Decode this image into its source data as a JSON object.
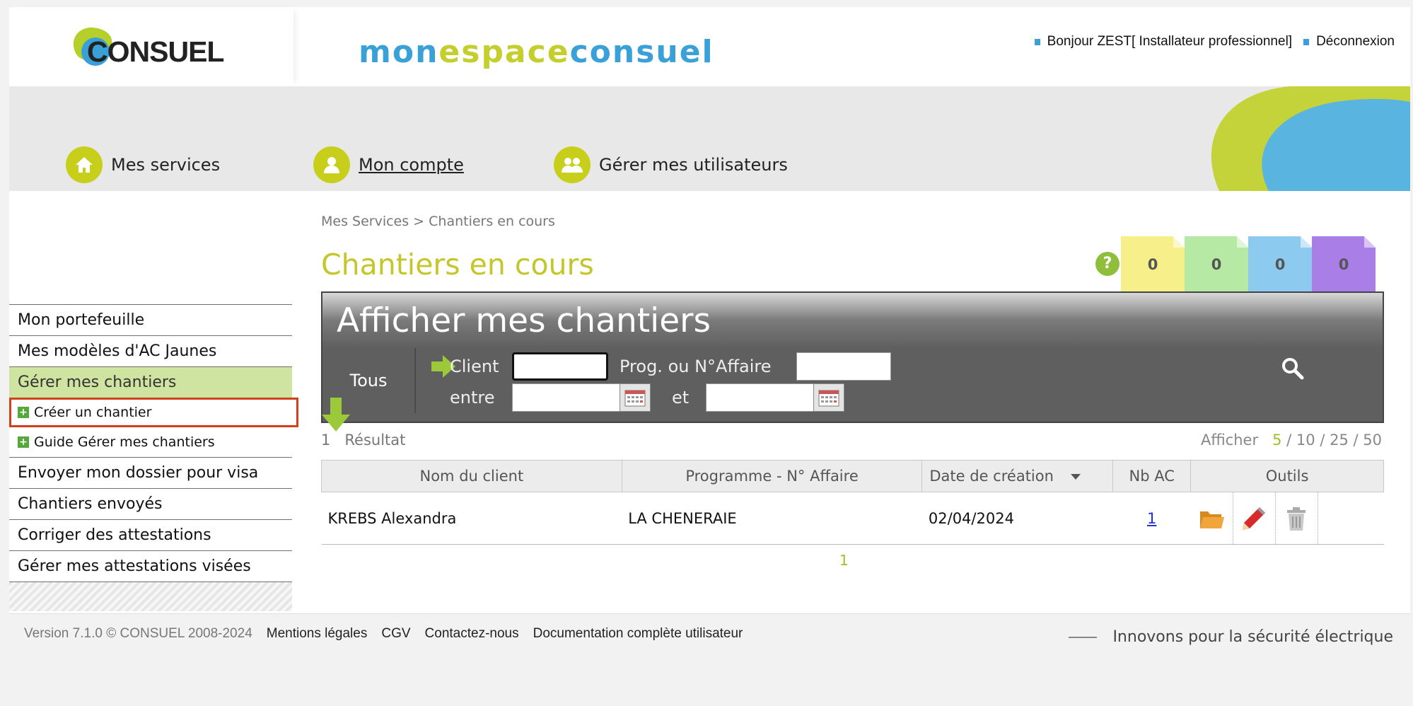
{
  "header": {
    "logo_text": "CONSUEL",
    "brand_part1": "mon",
    "brand_part2": "espace",
    "brand_part3": "consuel",
    "greeting": "Bonjour ZEST[ Installateur professionnel]",
    "logout_label": "Déconnexion"
  },
  "nav": {
    "services_label": "Mes services",
    "account_label": "Mon compte",
    "users_label": "Gérer mes utilisateurs"
  },
  "sidebar": {
    "items": [
      {
        "label": "Mon portefeuille"
      },
      {
        "label": "Mes modèles d'AC Jaunes"
      },
      {
        "label": "Gérer mes chantiers"
      },
      {
        "label": "Créer un chantier"
      },
      {
        "label": "Guide Gérer mes chantiers"
      },
      {
        "label": "Envoyer mon dossier pour visa"
      },
      {
        "label": "Chantiers envoyés"
      },
      {
        "label": "Corriger des attestations"
      },
      {
        "label": "Gérer mes attestations visées"
      }
    ]
  },
  "main": {
    "breadcrumb": "Mes Services > Chantiers en cours",
    "title": "Chantiers en cours",
    "help_symbol": "?",
    "counters": [
      {
        "value": "0",
        "color": "#f7ef8a"
      },
      {
        "value": "0",
        "color": "#b6e9a4"
      },
      {
        "value": "0",
        "color": "#8ccbef"
      },
      {
        "value": "0",
        "color": "#a97ee6"
      }
    ]
  },
  "filter": {
    "heading": "Afficher mes chantiers",
    "all_label": "Tous",
    "client_label": "Client",
    "client_value": "",
    "prog_label": "Prog. ou N°Affaire",
    "prog_value": "",
    "between_label": "entre",
    "and_label": "et",
    "date_from": "",
    "date_to": ""
  },
  "results": {
    "count": "1",
    "label": "Résultat",
    "show_label": "Afficher",
    "page_sizes": [
      "5",
      "10",
      "25",
      "50"
    ],
    "current_size": "5",
    "separator": " / "
  },
  "table": {
    "columns": [
      "Nom du client",
      "Programme - N° Affaire",
      "Date de création",
      "Nb AC",
      "Outils"
    ],
    "rows": [
      {
        "client": "KREBS Alexandra",
        "programme": "LA CHENERAIE",
        "date": "02/04/2024",
        "nb_ac": "1"
      }
    ]
  },
  "pagination": {
    "current_page": "1"
  },
  "footer": {
    "version": "Version 7.1.0 © CONSUEL 2008-2024",
    "links": [
      "Mentions légales",
      "CGV",
      "Contactez-nous",
      "Documentation complète utilisateur"
    ],
    "slogan": "Innovons pour la sécurité électrique"
  }
}
